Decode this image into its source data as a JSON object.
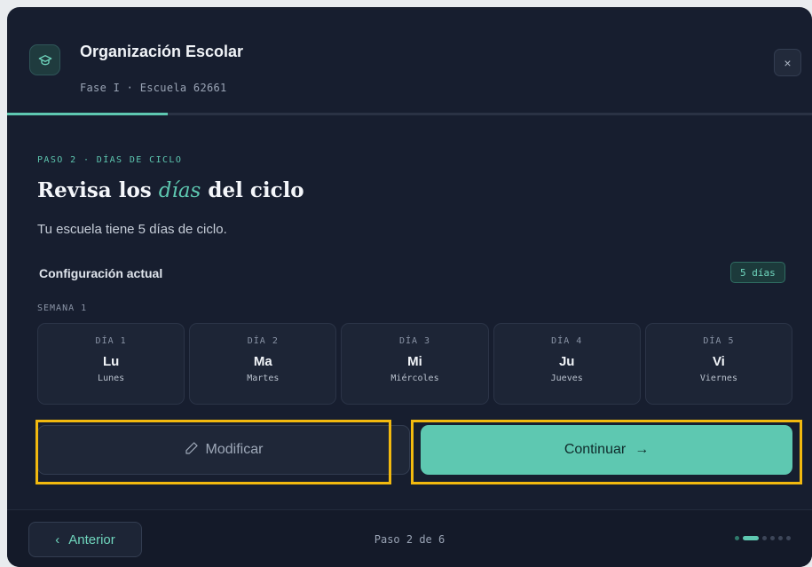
{
  "header": {
    "title": "Organización Escolar",
    "subtitle": "Fase I · Escuela 62661",
    "close_label": "×",
    "progress_fraction": 0.2
  },
  "step": {
    "label": "PASO 2 · DÍAS DE CICLO",
    "heading_before": "Revisa los ",
    "heading_emphasis": "días",
    "heading_after": " del ciclo",
    "description": "Tu escuela tiene 5 días de ciclo."
  },
  "config": {
    "title": "Configuración actual",
    "badge": "5 días",
    "week_label": "SEMANA 1",
    "days": [
      {
        "num": "DÍA 1",
        "abbr": "Lu",
        "full": "Lunes"
      },
      {
        "num": "DÍA 2",
        "abbr": "Ma",
        "full": "Martes"
      },
      {
        "num": "DÍA 3",
        "abbr": "Mi",
        "full": "Miércoles"
      },
      {
        "num": "DÍA 4",
        "abbr": "Ju",
        "full": "Jueves"
      },
      {
        "num": "DÍA 5",
        "abbr": "Vi",
        "full": "Viernes"
      }
    ]
  },
  "actions": {
    "modify_label": "Modificar",
    "continue_label": "Continuar",
    "continue_arrow": "→"
  },
  "footer": {
    "prev_arrow": "‹",
    "prev_label": "Anterior",
    "page_indicator": "Paso 2 de 6",
    "total_steps": 6,
    "current_step": 2
  },
  "colors": {
    "accent": "#5ec8b1",
    "background": "#171e2f",
    "highlight": "#f2b90f"
  }
}
